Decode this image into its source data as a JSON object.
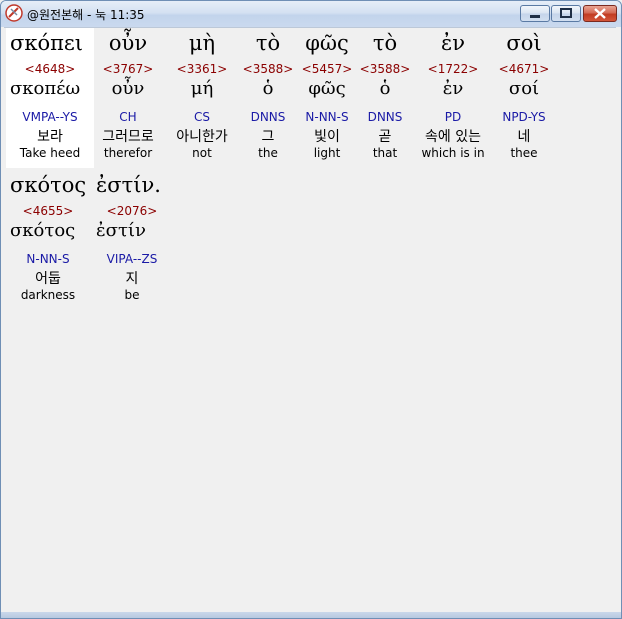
{
  "window": {
    "title": "@원전본해 - 눅 11:35"
  },
  "words": [
    {
      "greek": "σκόπει",
      "strong": "<4648>",
      "lemma": "σκοπέω",
      "parsing": "VMPA--YS",
      "korean": "보라",
      "english": "Take heed"
    },
    {
      "greek": "οὖν",
      "strong": "<3767>",
      "lemma": "οὖν",
      "parsing": "CH",
      "korean": "그러므로",
      "english": "therefor"
    },
    {
      "greek": "μὴ",
      "strong": "<3361>",
      "lemma": "μή",
      "parsing": "CS",
      "korean": "아니한가",
      "english": "not"
    },
    {
      "greek": "τὸ",
      "strong": "<3588>",
      "lemma": "ὁ",
      "parsing": "DNNS",
      "korean": "그",
      "english": "the"
    },
    {
      "greek": "φῶς",
      "strong": "<5457>",
      "lemma": "φῶς",
      "parsing": "N-NN-S",
      "korean": "빛이",
      "english": "light"
    },
    {
      "greek": "τὸ",
      "strong": "<3588>",
      "lemma": "ὁ",
      "parsing": "DNNS",
      "korean": "곧",
      "english": "that"
    },
    {
      "greek": "ἐν",
      "strong": "<1722>",
      "lemma": "ἐν",
      "parsing": "PD",
      "korean": "속에 있는",
      "english": "which is in"
    },
    {
      "greek": "σοὶ",
      "strong": "<4671>",
      "lemma": "σοί",
      "parsing": "NPD-YS",
      "korean": "네",
      "english": "thee"
    },
    {
      "greek": "σκότος",
      "strong": "<4655>",
      "lemma": "σκότος",
      "parsing": "N-NN-S",
      "korean": "어둡",
      "english": "darkness"
    },
    {
      "greek": "ἐστίν.",
      "strong": "<2076>",
      "lemma": "ἐστίν",
      "parsing": "VIPA--ZS",
      "korean": "지",
      "english": "be"
    }
  ]
}
